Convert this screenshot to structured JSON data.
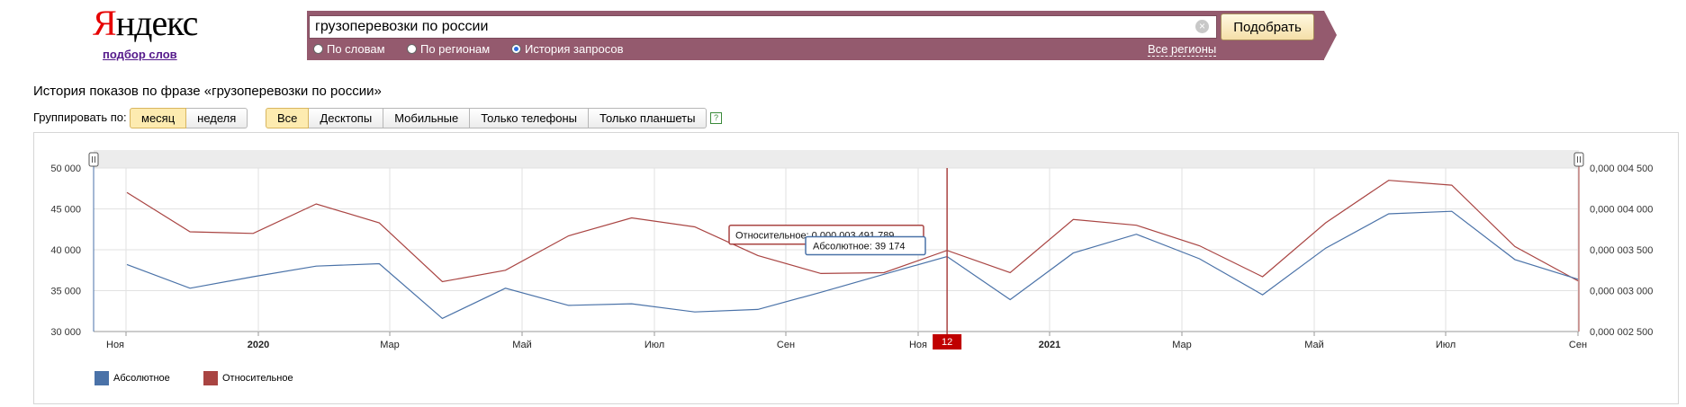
{
  "logo": {
    "text_first": "Я",
    "text_rest": "ндекс",
    "sub_link": "подбор слов"
  },
  "search": {
    "query": "грузоперевозки по россии",
    "clear_icon": "clear-icon",
    "button_label": "Подобрать",
    "radios": [
      {
        "label": "По словам",
        "selected": false
      },
      {
        "label": "По регионам",
        "selected": false
      },
      {
        "label": "История запросов",
        "selected": true
      }
    ],
    "regions_link": "Все регионы"
  },
  "history": {
    "title": "История показов по фразе «грузоперевозки по россии»",
    "group_by_label": "Группировать по:",
    "group_options": [
      {
        "label": "месяц",
        "active": true
      },
      {
        "label": "неделя",
        "active": false
      }
    ],
    "device_options": [
      {
        "label": "Все",
        "active": true
      },
      {
        "label": "Десктопы",
        "active": false
      },
      {
        "label": "Мобильные",
        "active": false
      },
      {
        "label": "Только телефоны",
        "active": false
      },
      {
        "label": "Только планшеты",
        "active": false
      }
    ],
    "help_icon": "?"
  },
  "colors": {
    "absolute": "#4a72a8",
    "relative": "#a94442",
    "band": "#945a6e"
  },
  "chart_data": {
    "type": "line",
    "x": [
      "2019-11",
      "2019-12",
      "2020-01",
      "2020-02",
      "2020-03",
      "2020-04",
      "2020-05",
      "2020-06",
      "2020-07",
      "2020-08",
      "2020-09",
      "2020-10",
      "2020-11",
      "2020-12",
      "2021-01",
      "2021-02",
      "2021-03",
      "2021-04",
      "2021-05",
      "2021-06",
      "2021-07",
      "2021-08",
      "2021-09",
      "2021-10"
    ],
    "x_tick_labels": [
      "Ноя",
      "2020",
      "Мар",
      "Май",
      "Июл",
      "Сен",
      "Ноя",
      "2021",
      "Мар",
      "Май",
      "Июл",
      "Сен"
    ],
    "bold_tick_labels": [
      "2020",
      "2021"
    ],
    "y_left": {
      "ticks": [
        "30 000",
        "35 000",
        "40 000",
        "45 000",
        "50 000"
      ],
      "range": [
        30000,
        50000
      ]
    },
    "y_right": {
      "ticks": [
        "0,000 002 500",
        "0,000 003 000",
        "0,000 003 500",
        "0,000 004 000",
        "0,000 004 500"
      ],
      "range": [
        2.5e-06,
        4.5e-06
      ]
    },
    "series": [
      {
        "name": "Абсолютное",
        "axis": "left",
        "values": [
          38200,
          35300,
          36700,
          38000,
          38300,
          31600,
          35300,
          33200,
          33400,
          32400,
          32700,
          34800,
          37000,
          39174,
          33900,
          39600,
          41900,
          38900,
          34500,
          40200,
          44400,
          44700,
          38800,
          36400
        ]
      },
      {
        "name": "Относительное",
        "axis": "right",
        "values": [
          4.2e-06,
          3.72e-06,
          3.7e-06,
          4.06e-06,
          3.83e-06,
          3.11e-06,
          3.25e-06,
          3.67e-06,
          3.89e-06,
          3.78e-06,
          3.43e-06,
          3.21e-06,
          3.22e-06,
          3.491789e-06,
          3.22e-06,
          3.87e-06,
          3.8e-06,
          3.55e-06,
          3.17e-06,
          3.83e-06,
          4.35e-06,
          4.29e-06,
          3.54e-06,
          3.12e-06
        ]
      }
    ],
    "tooltip": {
      "relative": "Относительное: 0,000 003 491 789",
      "absolute": "Абсолютное: 39 174",
      "marker_label": "12"
    },
    "legend": [
      "Абсолютное",
      "Относительное"
    ],
    "grid": true
  }
}
